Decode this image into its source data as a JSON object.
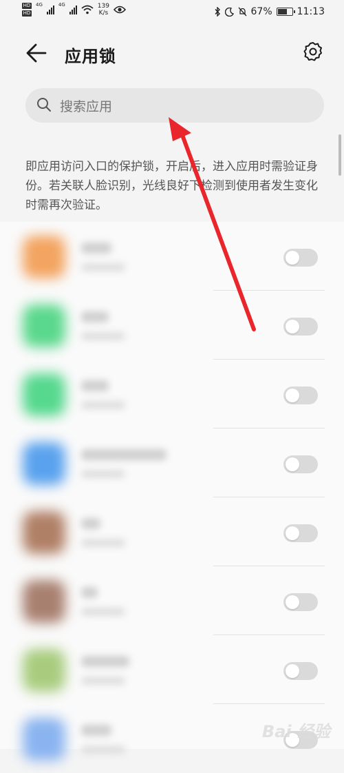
{
  "status_bar": {
    "hd_labels": [
      "HD",
      "HD"
    ],
    "net_type_1": "4G",
    "net_type_2": "4G",
    "speed_value": "139",
    "speed_unit": "K/s",
    "battery": "67%",
    "time": "11:13"
  },
  "header": {
    "title": "应用锁"
  },
  "search": {
    "placeholder": "搜索应用"
  },
  "description": "即应用访问入口的保护锁，开启后，进入应用时需验证身份。若关联人脸识别，光线良好下检测到使用者发生变化时需再次验证。",
  "app_list": [
    {
      "icon_color": "#f3a460",
      "enabled": false
    },
    {
      "icon_color": "#5ad88c",
      "enabled": false
    },
    {
      "icon_color": "#56d88e",
      "enabled": false
    },
    {
      "icon_color": "#5aa2ee",
      "enabled": false
    },
    {
      "icon_color": "#b08066",
      "enabled": false
    },
    {
      "icon_color": "#a88070",
      "enabled": false
    },
    {
      "icon_color": "#a8cc7e",
      "enabled": false
    },
    {
      "icon_color": "#8ab4f0",
      "enabled": false
    }
  ],
  "icons": {
    "back": "arrow-left-icon",
    "settings": "gear-icon",
    "search": "search-icon",
    "annotation": "red-arrow-annotation"
  },
  "colors": {
    "annotation_arrow": "#e8262b",
    "toggle_off": "#dadada"
  },
  "watermark": "Bai 经验"
}
